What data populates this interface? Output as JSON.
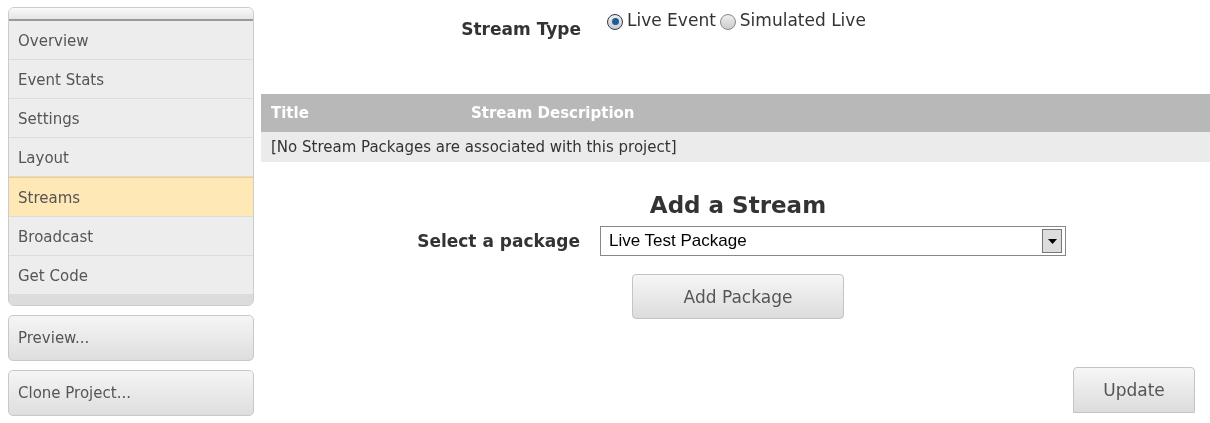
{
  "sidebar": {
    "items": [
      {
        "label": "Overview",
        "selected": false
      },
      {
        "label": "Event Stats",
        "selected": false
      },
      {
        "label": "Settings",
        "selected": false
      },
      {
        "label": "Layout",
        "selected": false
      },
      {
        "label": "Streams",
        "selected": true
      },
      {
        "label": "Broadcast",
        "selected": false
      },
      {
        "label": "Get Code",
        "selected": false
      }
    ],
    "buttons": [
      "Preview...",
      "Clone Project..."
    ]
  },
  "stream_type": {
    "label": "Stream Type",
    "options": [
      {
        "label": "Live Event",
        "selected": true
      },
      {
        "label": "Simulated Live",
        "selected": false
      }
    ]
  },
  "table": {
    "columns": [
      "Title",
      "Stream Description"
    ],
    "empty_message": "[No Stream Packages are associated with this project]"
  },
  "add_stream": {
    "heading": "Add a Stream",
    "select_label": "Select a package",
    "select_value": "Live Test Package",
    "button": "Add Package"
  },
  "update_button": "Update"
}
